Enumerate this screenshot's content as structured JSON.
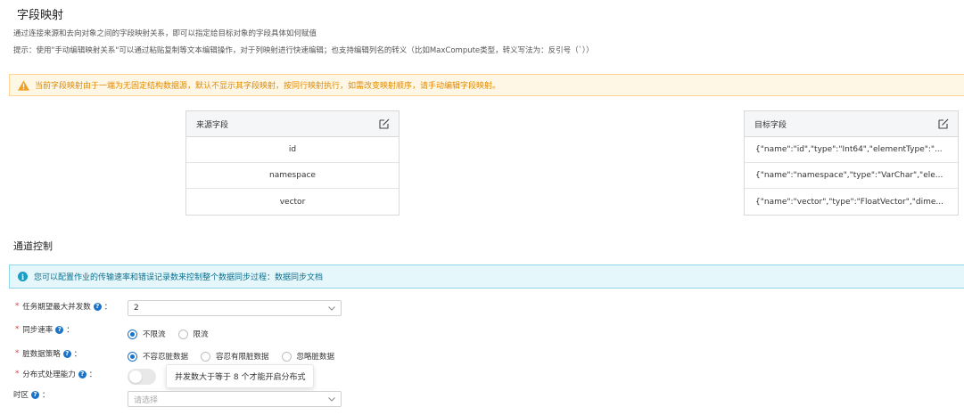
{
  "field_mapping": {
    "title": "字段映射",
    "desc1": "通过连接来源和去向对象之间的字段映射关系，即可以指定给目标对象的字段具体如何赋值",
    "desc2": "提示：使用\"手动编辑映射关系\"可以通过粘贴复制等文本编辑操作，对于列映射进行快速编辑；也支持编辑列名的转义（比如MaxCompute类型，转义写法为：反引号（`））",
    "warning": "当前字段映射由于一端为无固定结构数据源，默认不显示其字段映射，按同行映射执行，如需改变映射顺序，请手动编辑字段映射。",
    "source": {
      "header": "来源字段",
      "rows": [
        "id",
        "namespace",
        "vector"
      ]
    },
    "target": {
      "header": "目标字段",
      "rows": [
        "{\"name\":\"id\",\"type\":\"Int64\",\"elementType\":\"...",
        "{\"name\":\"namespace\",\"type\":\"VarChar\",\"ele...",
        "{\"name\":\"vector\",\"type\":\"FloatVector\",\"dime..."
      ]
    }
  },
  "channel": {
    "title": "通道控制",
    "info": "您可以配置作业的传输速率和错误记录数来控制整个数据同步过程：数据同步文档",
    "concurrency": {
      "label": "任务期望最大并发数",
      "value": "2"
    },
    "speed": {
      "label": "同步速率",
      "options": [
        "不限流",
        "限流"
      ],
      "selected": 0
    },
    "dirty": {
      "label": "脏数据策略",
      "options": [
        "不容忍脏数据",
        "容忍有限脏数据",
        "忽略脏数据"
      ],
      "selected": 0
    },
    "distributed": {
      "label": "分布式处理能力",
      "enabled": false,
      "tooltip": "并发数大于等于 8 个才能开启分布式"
    },
    "timezone": {
      "label": "时区",
      "placeholder": "请选择"
    },
    "colon": "：",
    "required_mark": "*",
    "help_mark": "?"
  },
  "icons": {
    "warning": "warning-triangle-icon",
    "info": "info-circle-icon",
    "edit": "edit-icon",
    "chevron": "chevron-down-icon",
    "help": "question-circle-icon"
  },
  "colors": {
    "accent": "#1a73c8",
    "warning": "#e08a00",
    "info": "#1a9cc4"
  }
}
